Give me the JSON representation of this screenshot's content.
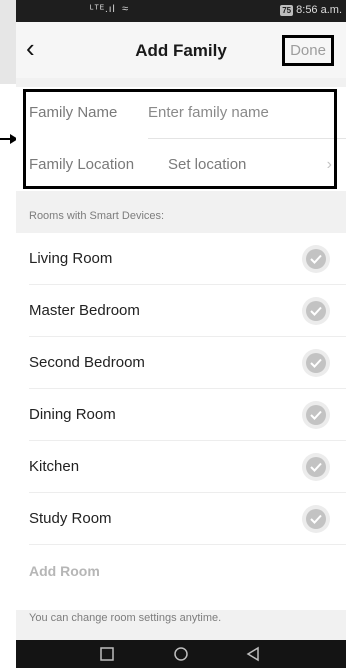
{
  "status_bar": {
    "signal": "ᴸᵀᴱ.ıl",
    "wifi": "≈",
    "battery": "75",
    "time": "8:56 a.m."
  },
  "header": {
    "back_icon": "‹",
    "title": "Add Family",
    "done_label": "Done"
  },
  "form": {
    "family_name_label": "Family Name",
    "family_name_placeholder": "Enter family name",
    "family_location_label": "Family Location",
    "family_location_value": "Set location",
    "chevron": "›"
  },
  "rooms": {
    "section_title": "Rooms with Smart Devices:",
    "items": [
      {
        "name": "Living Room",
        "checked": true
      },
      {
        "name": "Master Bedroom",
        "checked": true
      },
      {
        "name": "Second Bedroom",
        "checked": true
      },
      {
        "name": "Dining Room",
        "checked": true
      },
      {
        "name": "Kitchen",
        "checked": true
      },
      {
        "name": "Study Room",
        "checked": true
      }
    ],
    "add_room_label": "Add Room"
  },
  "footer_note": "You can change room settings anytime.",
  "icons": {
    "back": "chevron-left-icon",
    "check": "check-circle-icon",
    "location": "chevron-right-icon",
    "nav": [
      "square-icon",
      "circle-icon",
      "triangle-back-icon"
    ]
  },
  "colors": {
    "highlight_border": "#000000",
    "done_text": "#9d9d9d",
    "check_fill": "#c3c3c3"
  }
}
